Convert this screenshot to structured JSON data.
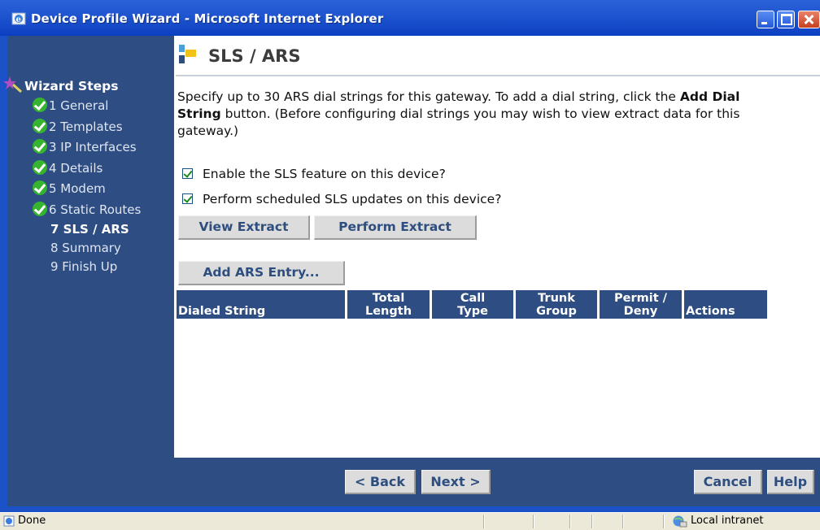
{
  "window": {
    "title": "Device Profile Wizard - Microsoft Internet Explorer"
  },
  "sidebar": {
    "heading": "Wizard Steps",
    "steps": [
      {
        "label": "1 General",
        "state": "done"
      },
      {
        "label": "2 Templates",
        "state": "done"
      },
      {
        "label": "3 IP Interfaces",
        "state": "done"
      },
      {
        "label": "4 Details",
        "state": "done"
      },
      {
        "label": "5 Modem",
        "state": "done"
      },
      {
        "label": "6 Static Routes",
        "state": "done"
      },
      {
        "label": "7 SLS / ARS",
        "state": "current"
      },
      {
        "label": "8 Summary",
        "state": "pending"
      },
      {
        "label": "9 Finish Up",
        "state": "pending"
      }
    ]
  },
  "main": {
    "title": "SLS / ARS",
    "intro_part1": "Specify up to 30 ARS dial strings for this gateway. To add a dial string, click the",
    "intro_bold": "Add Dial String",
    "intro_part2": "button. (Before configuring dial strings you may wish to view extract data for this gateway.)",
    "checkboxes": [
      {
        "label": "Enable the SLS feature on this device?",
        "checked": true
      },
      {
        "label": "Perform scheduled SLS updates on this device?",
        "checked": true
      }
    ],
    "buttons": {
      "view_extract": "View Extract",
      "perform_extract": "Perform Extract",
      "add_ars_entry": "Add ARS Entry..."
    },
    "table": {
      "columns": [
        {
          "line1": "",
          "line2": "Dialed String"
        },
        {
          "line1": "Total",
          "line2": "Length"
        },
        {
          "line1": "Call",
          "line2": "Type"
        },
        {
          "line1": "Trunk",
          "line2": "Group"
        },
        {
          "line1": "Permit /",
          "line2": "Deny"
        },
        {
          "line1": "",
          "line2": "Actions"
        }
      ],
      "rows": []
    }
  },
  "footer": {
    "back": "< Back",
    "next": "Next >",
    "cancel": "Cancel",
    "help": "Help"
  },
  "statusbar": {
    "status": "Done",
    "zone": "Local intranet"
  },
  "colors": {
    "sidebar_bg": "#2e4d82",
    "titlebar": "#1f54cf",
    "check_green": "#36b32f"
  }
}
